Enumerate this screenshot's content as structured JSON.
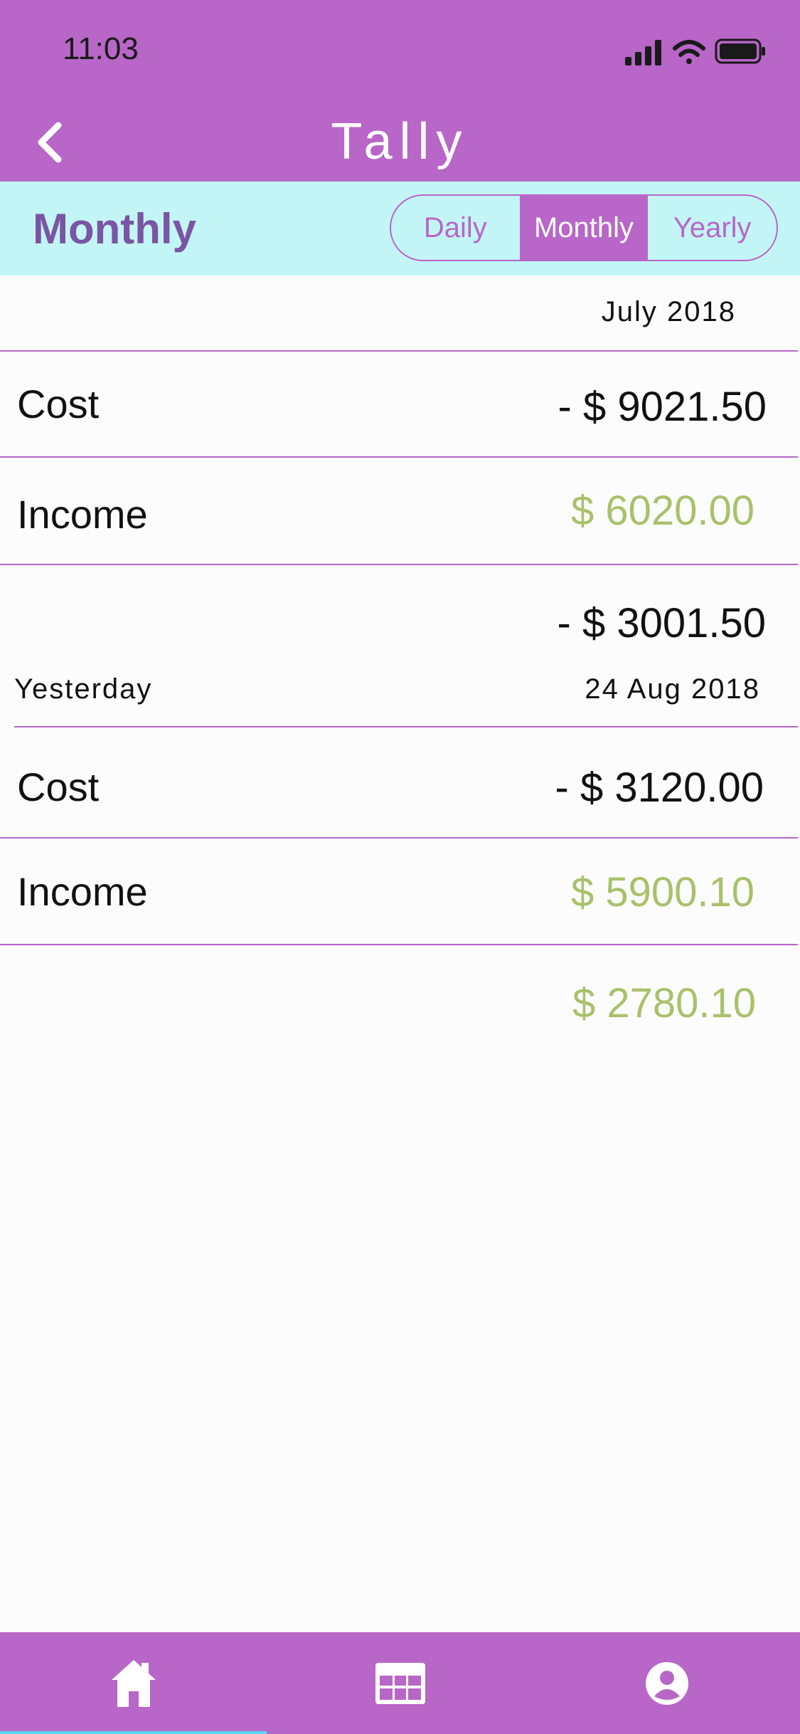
{
  "status_bar": {
    "time": "11:03"
  },
  "header": {
    "title": "Tally"
  },
  "period": {
    "heading": "Monthly",
    "options": [
      "Daily",
      "Monthly",
      "Yearly"
    ],
    "selected": "Monthly"
  },
  "sections": [
    {
      "label": "",
      "date": "July 2018",
      "rows": [
        {
          "label": "Cost",
          "amount": "- $ 9021.50",
          "type": "negative"
        },
        {
          "label": "Income",
          "amount": "$ 6020.00",
          "type": "positive"
        }
      ],
      "total": {
        "amount": "- $ 3001.50",
        "type": "negative"
      }
    },
    {
      "label": "Yesterday",
      "date": "24 Aug 2018",
      "rows": [
        {
          "label": "Cost",
          "amount": "- $ 3120.00",
          "type": "negative"
        },
        {
          "label": "Income",
          "amount": "$ 5900.10",
          "type": "positive"
        }
      ],
      "total": {
        "amount": "$ 2780.10",
        "type": "positive"
      }
    }
  ],
  "tabbar": {
    "items": [
      {
        "icon": "home-icon",
        "active": true
      },
      {
        "icon": "calendar-grid-icon",
        "active": false
      },
      {
        "icon": "account-icon",
        "active": false
      }
    ]
  },
  "colors": {
    "primary": "#b866c7",
    "segbar_bg": "#c3f5f7",
    "heading": "#7a55a3",
    "positive": "#a9c16a",
    "negative": "#111111",
    "tab_indicator": "#5fd4f0"
  }
}
